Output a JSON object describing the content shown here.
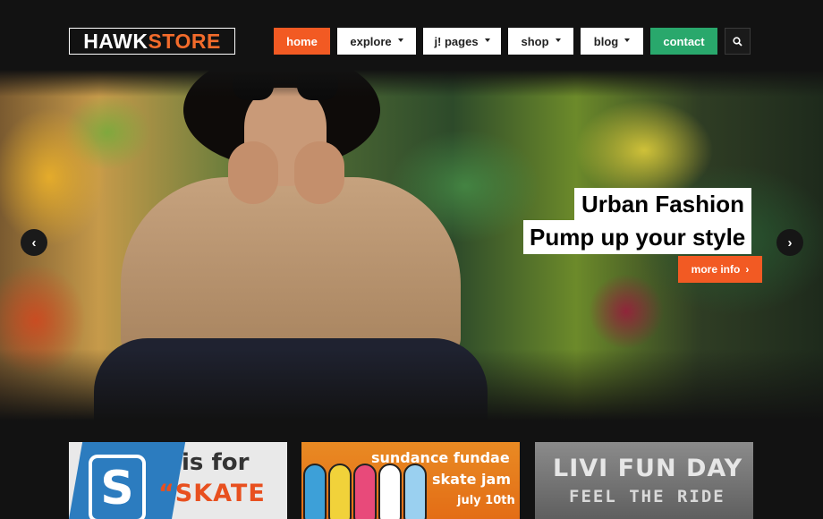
{
  "brand": {
    "logo_part1": "HAWK",
    "logo_part2": "STORE"
  },
  "nav": {
    "items": [
      {
        "label": "home"
      },
      {
        "label": "explore"
      },
      {
        "label": "j! pages"
      },
      {
        "label": "shop"
      },
      {
        "label": "blog"
      },
      {
        "label": "contact"
      }
    ],
    "search_icon": "search-icon"
  },
  "hero": {
    "caption_line1": "Urban Fashion",
    "caption_line2": "Pump up your style",
    "cta_label": "more info",
    "cta_icon": "›",
    "prev_icon": "‹",
    "next_icon": "›"
  },
  "banners": [
    {
      "line1": "is for",
      "line2": "“SKATE",
      "badge": "S"
    },
    {
      "line1": "sundance fundae",
      "line2": "skate jam",
      "line3": "july 10th"
    },
    {
      "line1": "LIVI FUN DAY",
      "line2": "FEEL THE RIDE"
    }
  ],
  "colors": {
    "accent_orange": "#f25a23",
    "contact_green": "#29a86c",
    "background": "#121212"
  }
}
